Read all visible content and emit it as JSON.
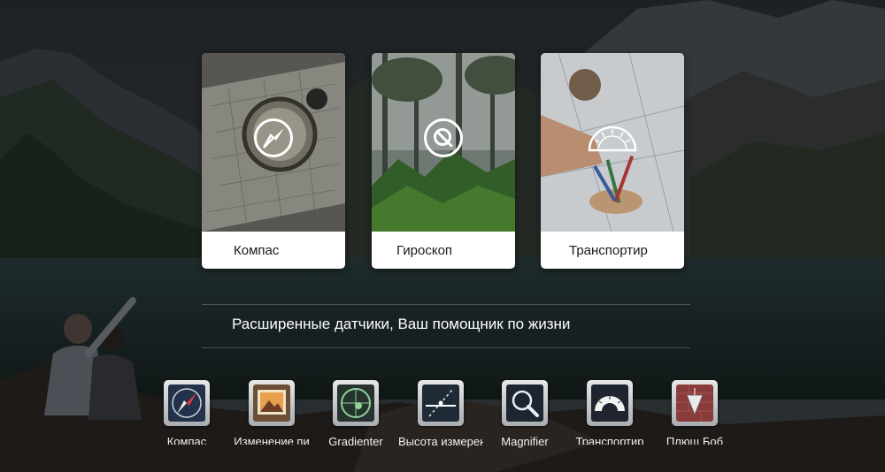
{
  "feature_cards": [
    {
      "label": "Компас",
      "icon": "compass-icon"
    },
    {
      "label": "Гироскоп",
      "icon": "gyroscope-icon"
    },
    {
      "label": "Транспортир",
      "icon": "protractor-icon"
    }
  ],
  "slogan": "Расширенные датчики, Ваш помощник по жизни",
  "tools": [
    {
      "label": "Компас",
      "icon": "compass-icon"
    },
    {
      "label": "Изменение пи",
      "icon": "picture-frame-icon"
    },
    {
      "label": "Gradienter",
      "icon": "level-icon"
    },
    {
      "label": "Высота измерения",
      "icon": "height-measure-icon"
    },
    {
      "label": "Magnifier",
      "icon": "magnifier-icon"
    },
    {
      "label": "Транспортир",
      "icon": "protractor-icon"
    },
    {
      "label": "Плющ Боб",
      "icon": "plumb-bob-icon"
    }
  ],
  "colors": {
    "card_background": "#ffffff",
    "text_light": "#ffffff",
    "text_dark": "#1a1a1a",
    "tile_dark": "#1e2b3a"
  }
}
